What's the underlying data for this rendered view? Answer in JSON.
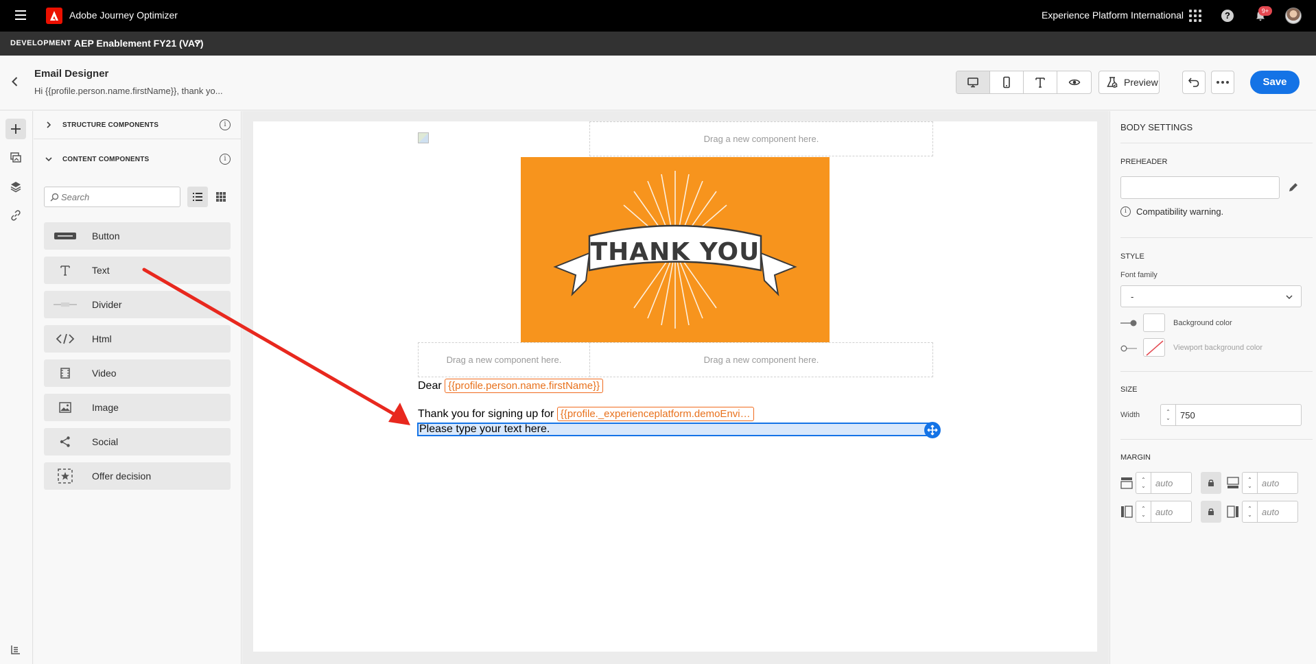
{
  "app": {
    "title": "Adobe Journey Optimizer",
    "org": "Experience Platform International",
    "notification_badge": "9+"
  },
  "sandbox": {
    "env_label": "DEVELOPMENT",
    "name": "AEP Enablement FY21 (VA7)"
  },
  "header": {
    "title": "Email Designer",
    "subject": "Hi {{profile.person.name.firstName}}, thank yo...",
    "preview_label": "Preview",
    "save_label": "Save",
    "view_modes": [
      "desktop-icon",
      "mobile-icon",
      "text-icon",
      "eye-icon"
    ]
  },
  "components": {
    "structure_label": "STRUCTURE COMPONENTS",
    "content_label": "CONTENT COMPONENTS",
    "search_placeholder": "Search",
    "items": [
      {
        "label": "Button",
        "icon": "button-icon"
      },
      {
        "label": "Text",
        "icon": "text-icon"
      },
      {
        "label": "Divider",
        "icon": "divider-icon"
      },
      {
        "label": "Html",
        "icon": "html-icon"
      },
      {
        "label": "Video",
        "icon": "video-icon"
      },
      {
        "label": "Image",
        "icon": "image-icon"
      },
      {
        "label": "Social",
        "icon": "social-icon"
      },
      {
        "label": "Offer decision",
        "icon": "offer-decision-icon"
      }
    ]
  },
  "canvas": {
    "dropzone_label": "Drag a new component here.",
    "banner_text": "THANK YOU",
    "dear_text": "Dear",
    "firstname_token": "{{profile.person.name.firstName}}",
    "thanks_text": "Thank you for signing up for",
    "demo_token": "{{profile._experienceplatform.demoEnvi…",
    "placeholder_text": "Please type your text here."
  },
  "settings": {
    "title": "BODY SETTINGS",
    "preheader_label": "PREHEADER",
    "compat_warning": "Compatibility warning.",
    "style_label": "STYLE",
    "font_family_label": "Font family",
    "font_family_value": "-",
    "bg_color_label": "Background color",
    "viewport_bg_label": "Viewport background color",
    "size_label": "SIZE",
    "width_label": "Width",
    "width_value": "750",
    "margin_label": "MARGIN",
    "margin_placeholder": "auto"
  },
  "colors": {
    "accent": "#1473e6",
    "banner": "#f7941d",
    "token": "#e8711c",
    "arrow": "#e8281e",
    "adobe_red": "#eb1000"
  }
}
